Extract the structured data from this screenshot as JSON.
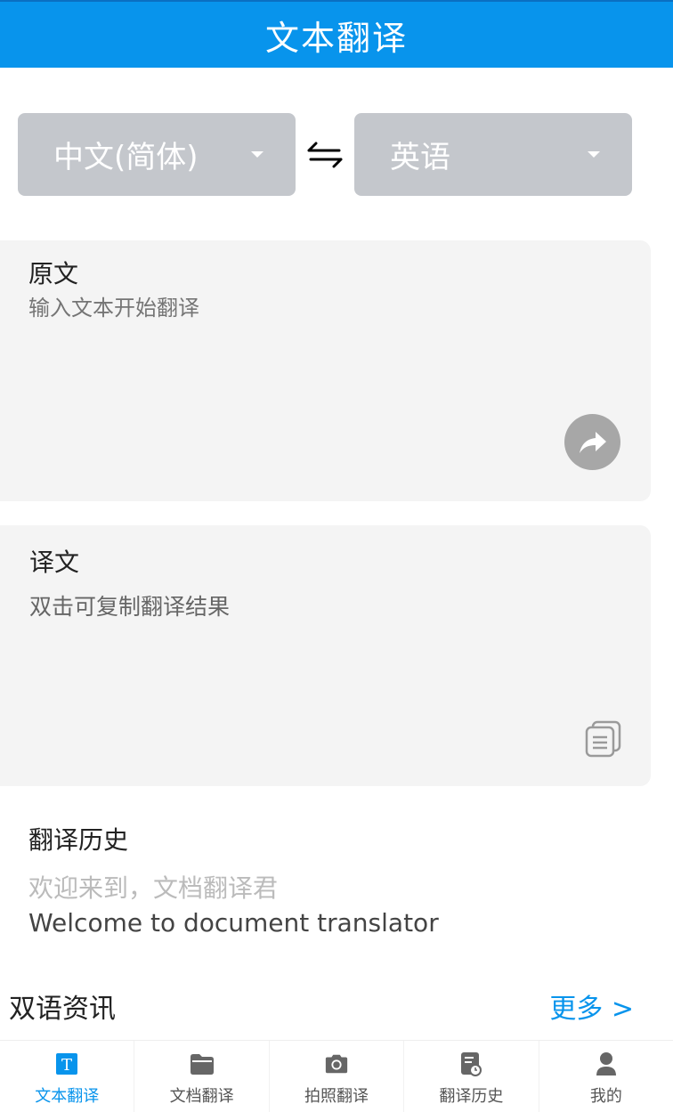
{
  "header": {
    "title": "文本翻译"
  },
  "languages": {
    "source": "中文(简体)",
    "target": "英语"
  },
  "source_panel": {
    "title": "原文",
    "placeholder": "输入文本开始翻译"
  },
  "target_panel": {
    "title": "译文",
    "hint": "双击可复制翻译结果"
  },
  "history": {
    "title": "翻译历史",
    "source_text": "欢迎来到，文档翻译君",
    "target_text": "Welcome to document translator"
  },
  "news": {
    "title": "双语资讯",
    "more": "更多 >"
  },
  "tabs": [
    {
      "label": "文本翻译",
      "icon": "text-icon"
    },
    {
      "label": "文档翻译",
      "icon": "folder-icon"
    },
    {
      "label": "拍照翻译",
      "icon": "camera-icon"
    },
    {
      "label": "翻译历史",
      "icon": "history-doc-icon"
    },
    {
      "label": "我的",
      "icon": "user-icon"
    }
  ],
  "colors": {
    "accent": "#0894ec",
    "select_bg": "#c4c7cc",
    "panel_bg": "#f4f4f4"
  }
}
